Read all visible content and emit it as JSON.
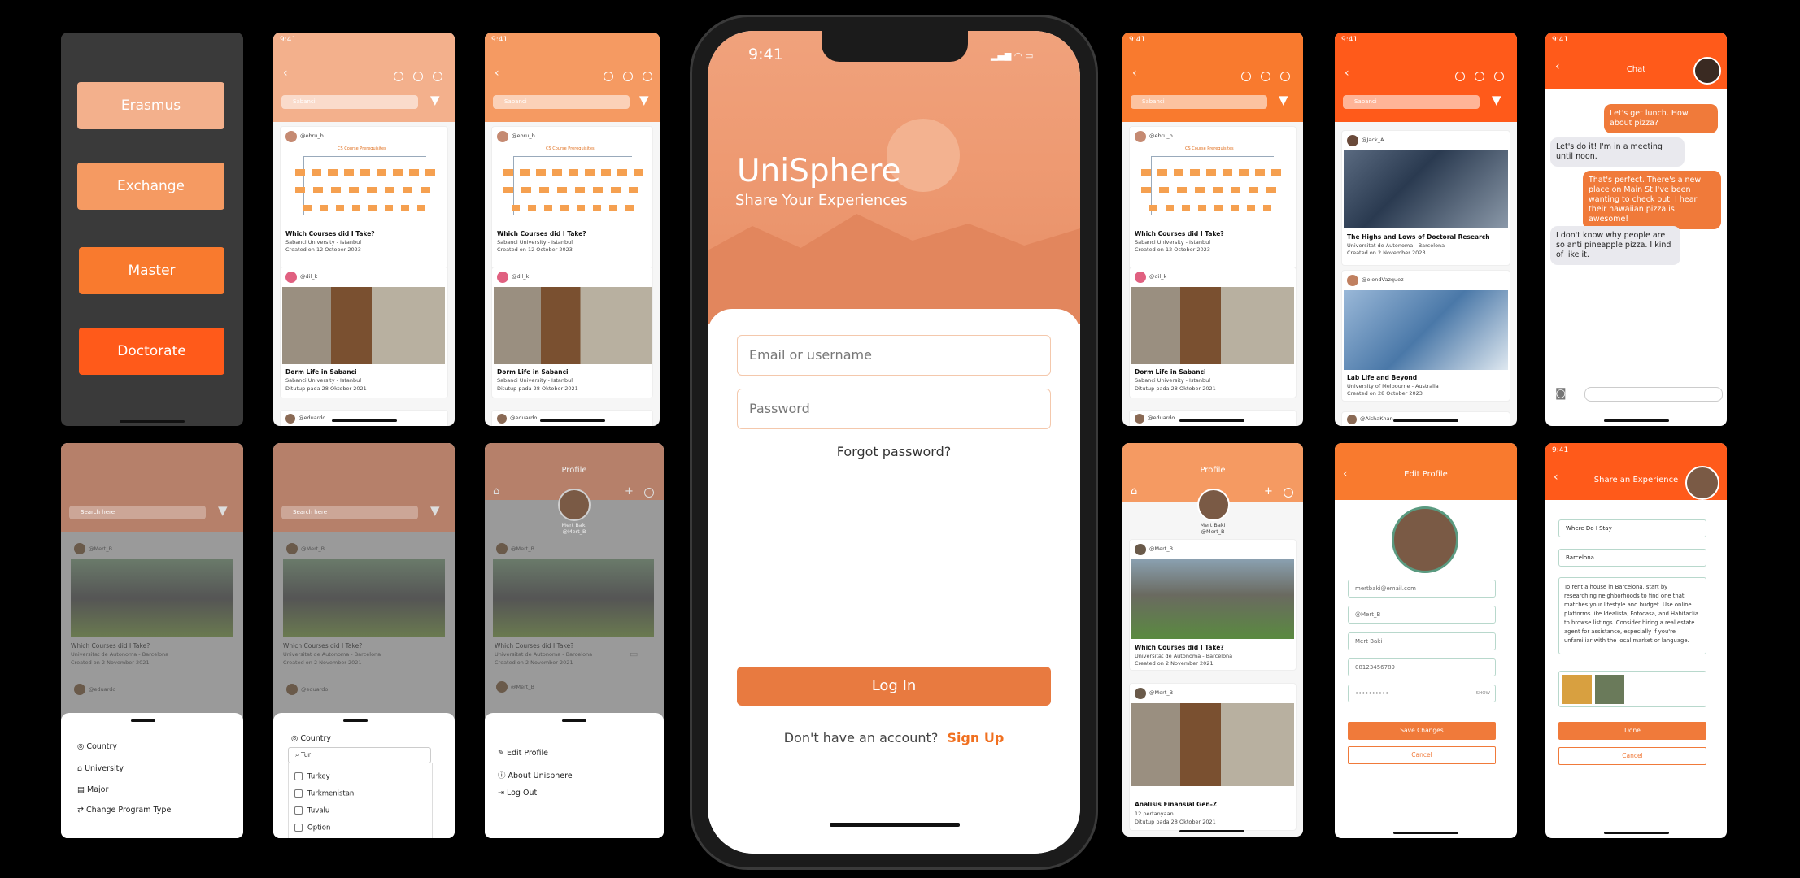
{
  "colors": {
    "accent": "#f07a3a",
    "peach": "#f3b08c",
    "light_orange": "#f59a62",
    "dark_orange": "#ff5a1a",
    "bg_dark": "#3a3a3a"
  },
  "program_types": [
    "Erasmus",
    "Exchange",
    "Master",
    "Doctorate"
  ],
  "status_time": "9:41",
  "search_placeholder": "Sabanci",
  "search_here": "Search here",
  "feed1": {
    "p1_user": "@ebru_b",
    "p1_title": "Which Courses did I Take?",
    "p1_uni": "Sabanci University - Istanbul",
    "p1_date": "Created on 12 October 2023",
    "p1_diagram_title": "CS Course Prerequisites",
    "p2_user": "@dil_k",
    "p2_title": "Dorm Life in Sabanci",
    "p2_uni": "Sabanci University - Istanbul",
    "p2_date": "Ditutup pada 28 Oktober 2021",
    "p3_user": "@eduardo"
  },
  "feed2": {
    "p1_user": "@Jack_A",
    "p1_title": "The Highs and Lows of Doctoral Research",
    "p1_uni": "Universitat de Autonoma - Barcelona",
    "p1_date": "Created on 2 November 2023",
    "p2_user": "@elendVazquez",
    "p2_title": "Lab Life and Beyond",
    "p2_uni": "University of Melbourne - Australia",
    "p2_date": "Created on 28 October 2023",
    "p3_user": "@AishaKhan"
  },
  "feed3": {
    "p1_user": "@Mert_B",
    "p1_title": "Which Courses did I Take?",
    "p1_uni": "Universitat de Autonoma - Barcelona",
    "p1_date": "Created on 2 November 2021",
    "p2_user": "@eduardo"
  },
  "filter_menu": [
    "Country",
    "University",
    "Major",
    "Change Program Type"
  ],
  "country_filter": {
    "label": "Country",
    "query": "Tur",
    "options": [
      "Turkey",
      "Turkmenistan",
      "Tuvalu",
      "Option"
    ]
  },
  "profile_menu": [
    "Edit Profile",
    "About Unisphere",
    "Log Out"
  ],
  "profile": {
    "title": "Profile",
    "name": "Mert Baki",
    "handle": "@Mert_B",
    "post2_title": "Analisis Finansial Gen-Z",
    "post2_sub": "12 pertanyaan",
    "post2_date": "Ditutup pada 28 Oktober 2021"
  },
  "login": {
    "time": "9:41",
    "app_name": "UniSphere",
    "tagline": "Share Your Experiences",
    "email_placeholder": "Email or username",
    "password_placeholder": "Password",
    "forgot": "Forgot password?",
    "login_button": "Log In",
    "no_account": "Don't have an account?",
    "signup": "Sign Up"
  },
  "chat": {
    "title": "Chat",
    "messages": [
      {
        "from": "me",
        "text": "Let's get lunch. How about pizza?"
      },
      {
        "from": "them",
        "text": "Let's do it! I'm in a meeting until noon."
      },
      {
        "from": "me",
        "text": "That's perfect. There's a new place on Main St I've been wanting to check out. I hear their hawaiian pizza is awesome!"
      },
      {
        "from": "them",
        "text": "I don't know why people are so anti pineapple pizza. I kind of like it."
      }
    ]
  },
  "edit_profile": {
    "title": "Edit Profile",
    "email": "mertbaki@email.com",
    "handle": "@Mert_B",
    "name": "Mert Baki",
    "phone": "08123456789",
    "password": "••••••••••",
    "show": "SHOW",
    "save": "Save Changes",
    "cancel": "Cancel"
  },
  "share": {
    "title": "Share an Experience",
    "field1": "Where Do I Stay",
    "field2": "Barcelona",
    "body": "To rent a house in Barcelona, start by researching neighborhoods to find one that matches your lifestyle and budget. Use online platforms like Idealista, Fotocasa, and Habitaclia to browse listings. Consider hiring a real estate agent for assistance, especially if you're unfamiliar with the local market or language.",
    "done": "Done",
    "cancel": "Cancel"
  }
}
